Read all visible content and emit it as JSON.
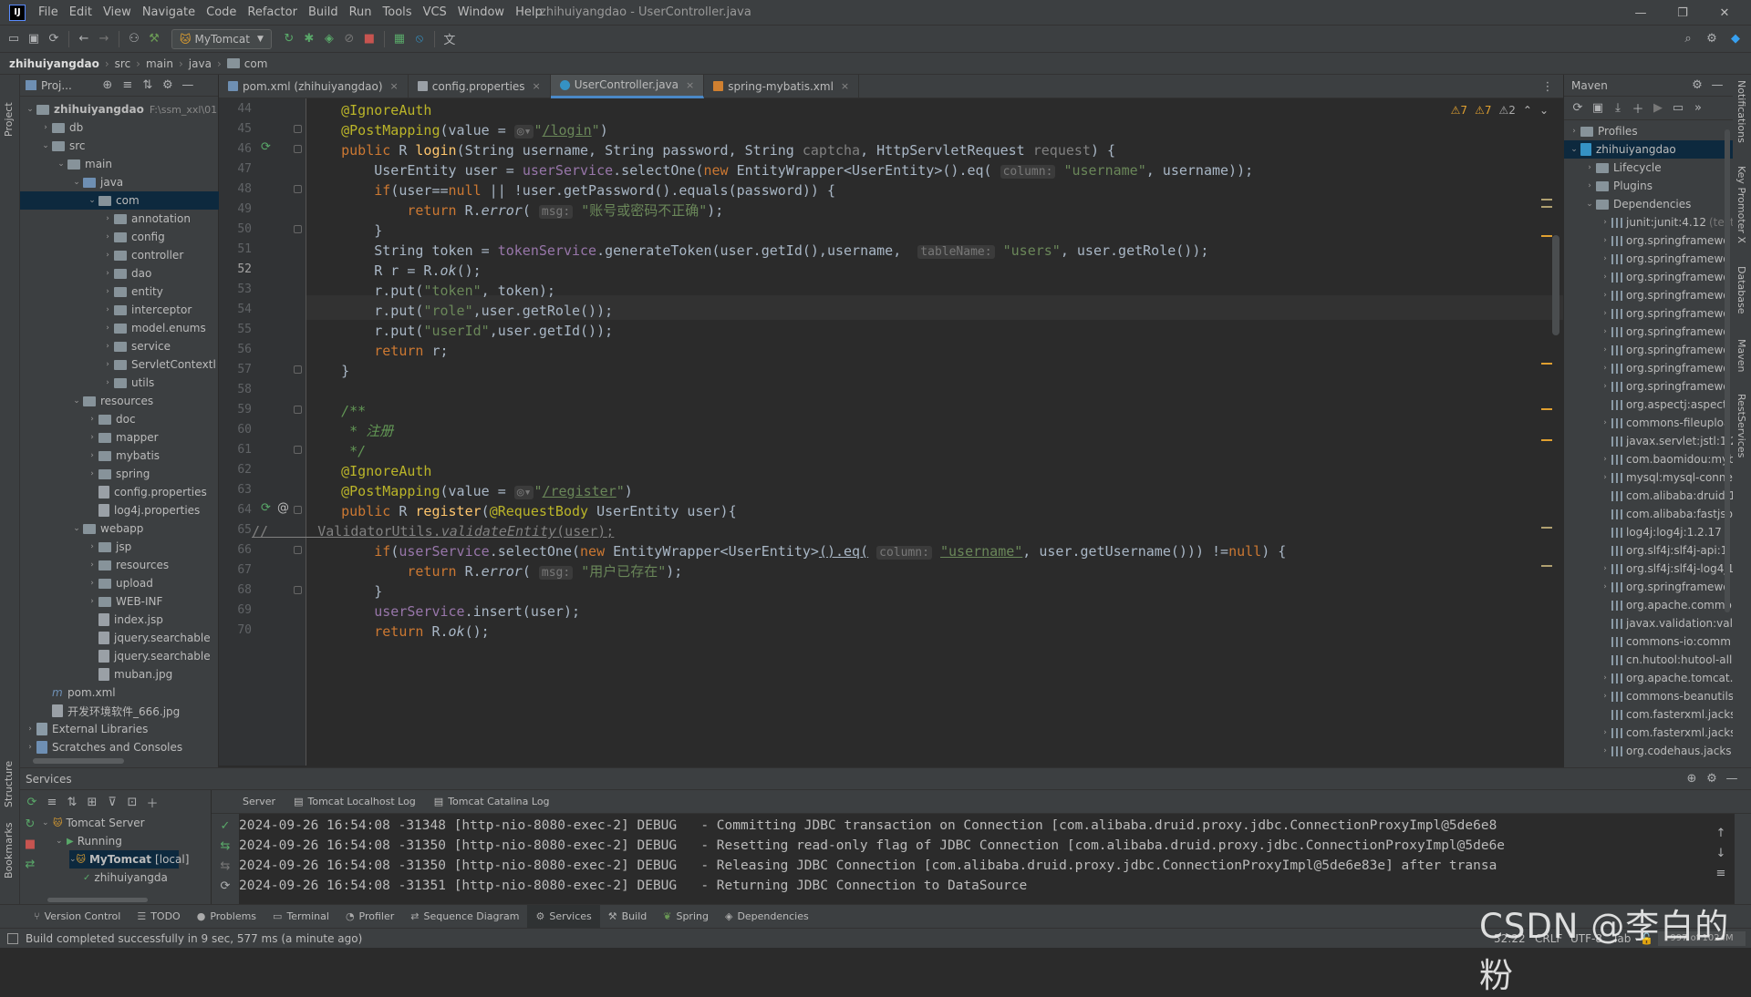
{
  "window": {
    "title": "zhihuiyangdao - UserController.java",
    "app_logo": "IJ"
  },
  "menu": [
    "File",
    "Edit",
    "View",
    "Navigate",
    "Code",
    "Refactor",
    "Build",
    "Run",
    "Tools",
    "VCS",
    "Window",
    "Help"
  ],
  "toolbar": {
    "run_config": "MyTomcat"
  },
  "breadcrumb": [
    "zhihuiyangdao",
    "src",
    "main",
    "java",
    "com"
  ],
  "project_panel": {
    "title": "Proj...",
    "strip_label": "Project",
    "tree": [
      {
        "label": "zhihuiyangdao",
        "extra": "F:\\ssm_xxl\\01",
        "depth": 0,
        "open": true,
        "kind": "folder",
        "bold": true
      },
      {
        "label": "db",
        "depth": 1,
        "open": false,
        "kind": "folder"
      },
      {
        "label": "src",
        "depth": 1,
        "open": true,
        "kind": "folder"
      },
      {
        "label": "main",
        "depth": 2,
        "open": true,
        "kind": "folder"
      },
      {
        "label": "java",
        "depth": 3,
        "open": true,
        "kind": "folder-blue"
      },
      {
        "label": "com",
        "depth": 4,
        "open": true,
        "kind": "folder",
        "selected": true
      },
      {
        "label": "annotation",
        "depth": 5,
        "open": false,
        "kind": "folder"
      },
      {
        "label": "config",
        "depth": 5,
        "open": false,
        "kind": "folder"
      },
      {
        "label": "controller",
        "depth": 5,
        "open": false,
        "kind": "folder"
      },
      {
        "label": "dao",
        "depth": 5,
        "open": false,
        "kind": "folder"
      },
      {
        "label": "entity",
        "depth": 5,
        "open": false,
        "kind": "folder"
      },
      {
        "label": "interceptor",
        "depth": 5,
        "open": false,
        "kind": "folder"
      },
      {
        "label": "model.enums",
        "depth": 5,
        "open": false,
        "kind": "folder"
      },
      {
        "label": "service",
        "depth": 5,
        "open": false,
        "kind": "folder"
      },
      {
        "label": "ServletContextl",
        "depth": 5,
        "open": false,
        "kind": "folder"
      },
      {
        "label": "utils",
        "depth": 5,
        "open": false,
        "kind": "folder"
      },
      {
        "label": "resources",
        "depth": 3,
        "open": true,
        "kind": "folder"
      },
      {
        "label": "doc",
        "depth": 4,
        "open": false,
        "kind": "folder"
      },
      {
        "label": "mapper",
        "depth": 4,
        "open": false,
        "kind": "folder"
      },
      {
        "label": "mybatis",
        "depth": 4,
        "open": false,
        "kind": "folder"
      },
      {
        "label": "spring",
        "depth": 4,
        "open": false,
        "kind": "folder"
      },
      {
        "label": "config.properties",
        "depth": 4,
        "kind": "file"
      },
      {
        "label": "log4j.properties",
        "depth": 4,
        "kind": "file"
      },
      {
        "label": "webapp",
        "depth": 3,
        "open": true,
        "kind": "folder"
      },
      {
        "label": "jsp",
        "depth": 4,
        "open": false,
        "kind": "folder"
      },
      {
        "label": "resources",
        "depth": 4,
        "open": false,
        "kind": "folder"
      },
      {
        "label": "upload",
        "depth": 4,
        "open": false,
        "kind": "folder"
      },
      {
        "label": "WEB-INF",
        "depth": 4,
        "open": false,
        "kind": "folder"
      },
      {
        "label": "index.jsp",
        "depth": 4,
        "kind": "file"
      },
      {
        "label": "jquery.searchable",
        "depth": 4,
        "kind": "file"
      },
      {
        "label": "jquery.searchable",
        "depth": 4,
        "kind": "file"
      },
      {
        "label": "muban.jpg",
        "depth": 4,
        "kind": "file"
      },
      {
        "label": "pom.xml",
        "depth": 1,
        "kind": "file-m"
      },
      {
        "label": "开发环境软件_666.jpg",
        "depth": 1,
        "kind": "file"
      },
      {
        "label": "External Libraries",
        "depth": 0,
        "open": false,
        "kind": "lib"
      },
      {
        "label": "Scratches and Consoles",
        "depth": 0,
        "open": false,
        "kind": "scratch"
      }
    ]
  },
  "editor": {
    "tabs": [
      {
        "label": "pom.xml (zhihuiyangdao)",
        "icon": "maven-file-icon"
      },
      {
        "label": "config.properties",
        "icon": "properties-file-icon"
      },
      {
        "label": "UserController.java",
        "icon": "java-class-icon",
        "active": true
      },
      {
        "label": "spring-mybatis.xml",
        "icon": "xml-file-icon"
      }
    ],
    "inspections": {
      "warn1": "7",
      "warn2": "7",
      "weak": "2"
    },
    "current_line": "52",
    "line_numbers": [
      "44",
      "45",
      "46",
      "47",
      "48",
      "49",
      "50",
      "51",
      "52",
      "53",
      "54",
      "55",
      "56",
      "57",
      "58",
      "59",
      "60",
      "61",
      "62",
      "63",
      "64",
      "65",
      "66",
      "67",
      "68",
      "69",
      "70"
    ]
  },
  "maven": {
    "title": "Maven",
    "items": [
      {
        "label": "Profiles",
        "depth": 0,
        "open": false,
        "kind": "folder"
      },
      {
        "label": "zhihuiyangdao",
        "depth": 0,
        "open": true,
        "kind": "module",
        "selected": true
      },
      {
        "label": "Lifecycle",
        "depth": 1,
        "open": false,
        "kind": "folder"
      },
      {
        "label": "Plugins",
        "depth": 1,
        "open": false,
        "kind": "folder"
      },
      {
        "label": "Dependencies",
        "depth": 1,
        "open": true,
        "kind": "folder"
      },
      {
        "label": "junit:junit:4.12",
        "extra": "(test)",
        "depth": 2,
        "open": false
      },
      {
        "label": "org.springframewo",
        "depth": 2,
        "open": false
      },
      {
        "label": "org.springframewo",
        "depth": 2,
        "open": false
      },
      {
        "label": "org.springframewo",
        "depth": 2,
        "open": false
      },
      {
        "label": "org.springframewo",
        "depth": 2,
        "open": false
      },
      {
        "label": "org.springframewo",
        "depth": 2,
        "open": false
      },
      {
        "label": "org.springframewo",
        "depth": 2,
        "open": false
      },
      {
        "label": "org.springframewo",
        "depth": 2,
        "open": false
      },
      {
        "label": "org.springframewo",
        "depth": 2,
        "open": false
      },
      {
        "label": "org.springframewo",
        "depth": 2,
        "open": false
      },
      {
        "label": "org.aspectj:aspectj",
        "depth": 2
      },
      {
        "label": "commons-fileuploa",
        "depth": 2,
        "open": false
      },
      {
        "label": "javax.servlet:jstl:1.2",
        "depth": 2
      },
      {
        "label": "com.baomidou:myb",
        "depth": 2,
        "open": false
      },
      {
        "label": "mysql:mysql-conne",
        "depth": 2,
        "open": false
      },
      {
        "label": "com.alibaba:druid:1",
        "depth": 2
      },
      {
        "label": "com.alibaba:fastjso",
        "depth": 2
      },
      {
        "label": "log4j:log4j:1.2.17",
        "depth": 2
      },
      {
        "label": "org.slf4j:slf4j-api:1",
        "depth": 2
      },
      {
        "label": "org.slf4j:slf4j-log4j1",
        "depth": 2,
        "open": false
      },
      {
        "label": "org.springframewo",
        "depth": 2,
        "open": false
      },
      {
        "label": "org.apache.commo",
        "depth": 2
      },
      {
        "label": "javax.validation:vali",
        "depth": 2
      },
      {
        "label": "commons-io:comm",
        "depth": 2
      },
      {
        "label": "cn.hutool:hutool-all:",
        "depth": 2
      },
      {
        "label": "org.apache.tomcat.",
        "depth": 2,
        "open": false
      },
      {
        "label": "commons-beanutils",
        "depth": 2,
        "open": false
      },
      {
        "label": "com.fasterxml.jacks",
        "depth": 2
      },
      {
        "label": "com.fasterxml.jacks",
        "depth": 2,
        "open": false
      },
      {
        "label": "org.codehaus.jacks",
        "depth": 2,
        "open": false
      }
    ]
  },
  "right_strip": [
    "Notifications",
    "Key Promoter X",
    "Database",
    "Maven",
    "RestServices"
  ],
  "left_strip_bottom": [
    "Structure",
    "Bookmarks"
  ],
  "services": {
    "title": "Services",
    "tree": [
      {
        "label": "Tomcat Server",
        "depth": 0
      },
      {
        "label": "Running",
        "depth": 1
      },
      {
        "label": "MyTomcat",
        "extra": "[local]",
        "depth": 2,
        "selected": true
      },
      {
        "label": "zhihuiyangda",
        "depth": 3
      }
    ],
    "tabs": [
      "Server",
      "Tomcat Localhost Log",
      "Tomcat Catalina Log"
    ],
    "console": [
      "2024-09-26 16:54:08 -31348 [http-nio-8080-exec-2] DEBUG   - Committing JDBC transaction on Connection [com.alibaba.druid.proxy.jdbc.ConnectionProxyImpl@5de6e8",
      "2024-09-26 16:54:08 -31350 [http-nio-8080-exec-2] DEBUG   - Resetting read-only flag of JDBC Connection [com.alibaba.druid.proxy.jdbc.ConnectionProxyImpl@5de6e",
      "2024-09-26 16:54:08 -31350 [http-nio-8080-exec-2] DEBUG   - Releasing JDBC Connection [com.alibaba.druid.proxy.jdbc.ConnectionProxyImpl@5de6e83e] after transa",
      "2024-09-26 16:54:08 -31351 [http-nio-8080-exec-2] DEBUG   - Returning JDBC Connection to DataSource"
    ]
  },
  "bottom_tabs": [
    {
      "label": "Version Control",
      "icon": "branch-icon"
    },
    {
      "label": "TODO",
      "icon": "list-icon"
    },
    {
      "label": "Problems",
      "icon": "info-icon"
    },
    {
      "label": "Terminal",
      "icon": "terminal-icon"
    },
    {
      "label": "Profiler",
      "icon": "profiler-icon"
    },
    {
      "label": "Sequence Diagram",
      "icon": "sequence-icon"
    },
    {
      "label": "Services",
      "icon": "services-icon",
      "active": true
    },
    {
      "label": "Build",
      "icon": "hammer-icon"
    },
    {
      "label": "Spring",
      "icon": "spring-icon"
    },
    {
      "label": "Dependencies",
      "icon": "dependencies-icon"
    }
  ],
  "statusbar": {
    "message": "Build completed successfully in 9 sec, 577 ms (a minute ago)",
    "position": "52:22",
    "line_sep": "CRLF",
    "encoding": "UTF-8",
    "indent": "Tab",
    "memory": "997 of 1024M"
  },
  "watermark": "CSDN @李白的粉"
}
